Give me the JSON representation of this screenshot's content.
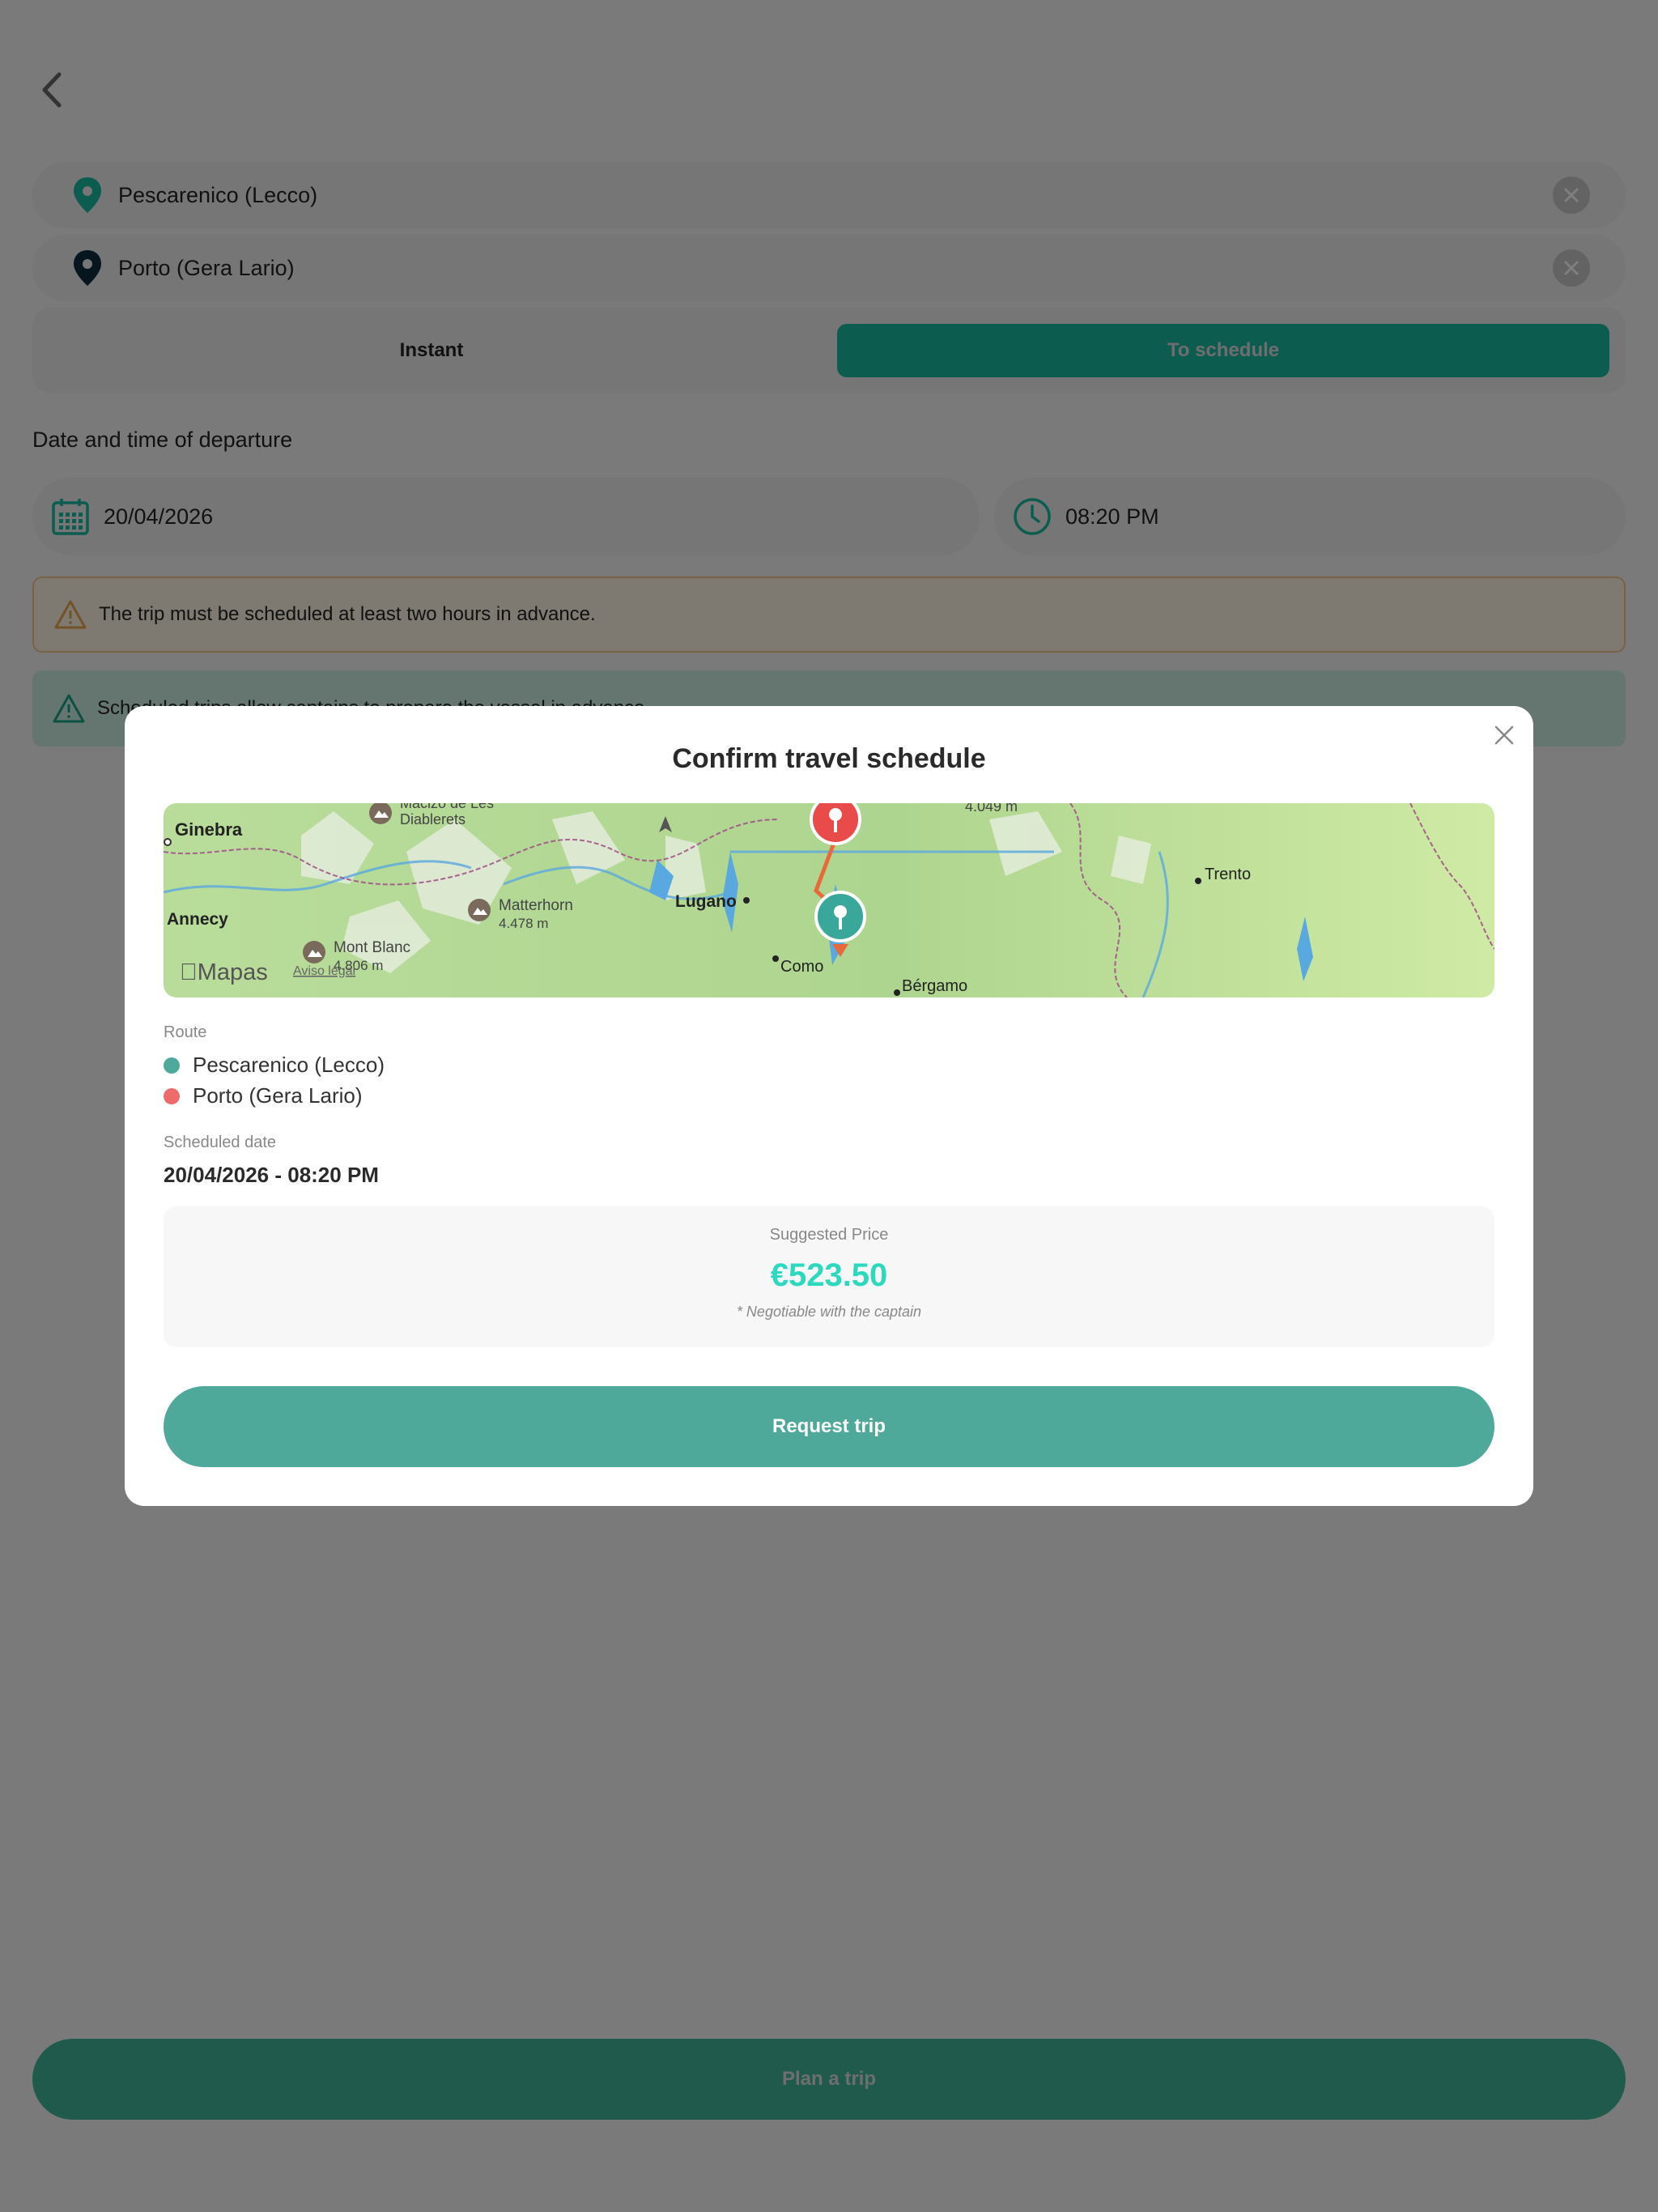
{
  "locations": {
    "origin": "Pescarenico (Lecco)",
    "destination": "Porto (Gera Lario)"
  },
  "mode": {
    "instant_label": "Instant",
    "schedule_label": "To schedule",
    "selected": "To schedule"
  },
  "departure": {
    "title": "Date and time of departure",
    "date": "20/04/2026",
    "time": "08:20 PM"
  },
  "notices": {
    "warning": "The trip must be scheduled at least two hours in advance.",
    "info": "Scheduled trips allow captains to prepare the vessel in advance."
  },
  "footer": {
    "plan_label": "Plan a trip"
  },
  "modal": {
    "title": "Confirm travel schedule",
    "map": {
      "labels": {
        "ginebra": "Ginebra",
        "macizo": "Macizo de Les",
        "diablerets": "Diablerets",
        "annecy": "Annecy",
        "matterhorn": "Matterhorn",
        "matterhorn_height": "4.478 m",
        "mont_blanc": "Mont Blanc",
        "mont_blanc_height": "4.806 m",
        "lugano": "Lugano",
        "como": "Como",
        "bergamo": "Bérgamo",
        "trento": "Trento",
        "peak_height": "4.049 m",
        "brand": "Mapas",
        "legal": "Aviso legal"
      }
    },
    "route_label": "Route",
    "route": [
      {
        "name": "Pescarenico (Lecco)",
        "color": "#4ea99b"
      },
      {
        "name": "Porto (Gera Lario)",
        "color": "#ee6b6b"
      }
    ],
    "scheduled_label": "Scheduled date",
    "scheduled_value": "20/04/2026 - 08:20 PM",
    "price_label": "Suggested Price",
    "price_value": "€523.50",
    "price_note": "* Negotiable with the captain",
    "request_label": "Request trip"
  },
  "colors": {
    "accent": "#18b8a0",
    "price": "#2cd9bf",
    "destination": "#ee6b6b"
  }
}
